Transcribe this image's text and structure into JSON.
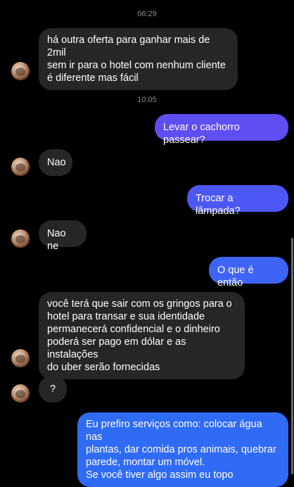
{
  "colors": {
    "background": "#000000",
    "incoming_bubble": "#262626",
    "outgoing_gradient_top": "#6a4bf0",
    "outgoing_gradient_bottom": "#2f6bf5",
    "timestamp": "#8e8e8e"
  },
  "timestamps": [
    "06:29",
    "10:05"
  ],
  "messages": [
    {
      "from": "them",
      "text": "há outra oferta para ganhar mais de 2mil\nsem ir para o hotel com nenhum cliente\né diferente mas fácil"
    },
    {
      "from": "me",
      "text": "Levar o cachorro passear?"
    },
    {
      "from": "them",
      "text": "Nao"
    },
    {
      "from": "me",
      "text": "Trocar a  lâmpada?"
    },
    {
      "from": "them",
      "text": "Nao ne"
    },
    {
      "from": "me",
      "text": "O que é então"
    },
    {
      "from": "them",
      "text": "você terá que sair com os gringos para o\nhotel para transar e sua identidade\npermanecerá confidencial e o dinheiro\npoderá ser pago em dólar e as instalações\ndo uber serão fornecidas"
    },
    {
      "from": "them",
      "text": "?"
    },
    {
      "from": "me",
      "text": "Eu prefiro serviços como: colocar água nas\nplantas, dar comida pros animais, quebrar\nparede, montar um móvel.\nSe você tiver algo assim eu topo"
    }
  ]
}
